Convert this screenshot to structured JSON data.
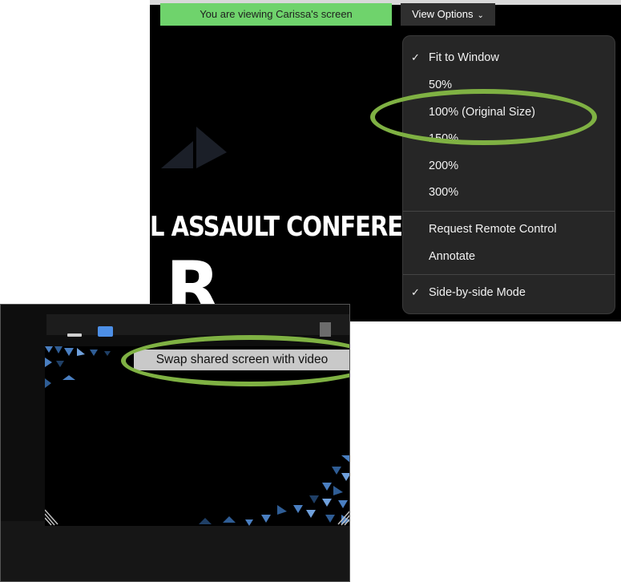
{
  "top_screenshot": {
    "banner_text": "You are viewing Carissa's screen",
    "view_options_label": "View Options",
    "conference_title": "L ASSAULT CONFERENCE",
    "big_letter": "R",
    "menu": {
      "zoom_items": [
        {
          "label": "Fit to Window",
          "checked": true
        },
        {
          "label": "50%",
          "checked": false
        },
        {
          "label": "100% (Original Size)",
          "checked": false,
          "highlighted": true
        },
        {
          "label": "150%",
          "checked": false
        },
        {
          "label": "200%",
          "checked": false
        },
        {
          "label": "300%",
          "checked": false
        }
      ],
      "control_items": [
        {
          "label": "Request Remote Control"
        },
        {
          "label": "Annotate"
        }
      ],
      "mode_items": [
        {
          "label": "Side-by-side Mode",
          "checked": true
        }
      ],
      "check_glyph": "✓"
    }
  },
  "bottom_screenshot": {
    "tooltip_text": "Swap shared screen with video"
  },
  "colors": {
    "banner_green": "#6fd36c",
    "highlight_ring": "#7fb143",
    "menu_bg": "#262626",
    "swap_button_blue": "#4d8fe6",
    "pattern_blue": "#4a7fc1"
  }
}
